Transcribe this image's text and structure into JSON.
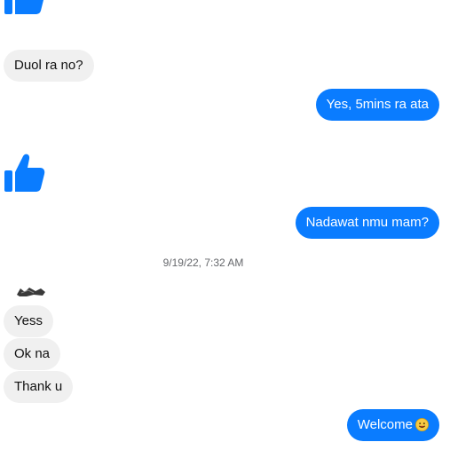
{
  "colors": {
    "accent": "#0a7cff",
    "incoming_bubble": "#f0f0f0",
    "incoming_text": "#111111",
    "outgoing_text": "#ffffff",
    "timestamp_text": "#65676b"
  },
  "messages": [
    {
      "kind": "like",
      "direction": "incoming",
      "icon": "thumbs-up-icon"
    },
    {
      "kind": "text",
      "direction": "incoming",
      "text": "Duol ra no?"
    },
    {
      "kind": "text",
      "direction": "outgoing",
      "text": "Yes, 5mins ra ata"
    },
    {
      "kind": "like",
      "direction": "incoming",
      "icon": "thumbs-up-icon"
    },
    {
      "kind": "text",
      "direction": "outgoing",
      "text": "Nadawat nmu mam?"
    },
    {
      "kind": "timestamp",
      "text": "9/19/22, 7:32 AM"
    },
    {
      "kind": "text",
      "direction": "incoming",
      "text": "Yess"
    },
    {
      "kind": "text",
      "direction": "incoming",
      "text": "Ok na"
    },
    {
      "kind": "text",
      "direction": "incoming",
      "text": "Thank u"
    },
    {
      "kind": "text",
      "direction": "outgoing",
      "text": "Welcome",
      "emoji": "smiling-face-icon"
    }
  ]
}
